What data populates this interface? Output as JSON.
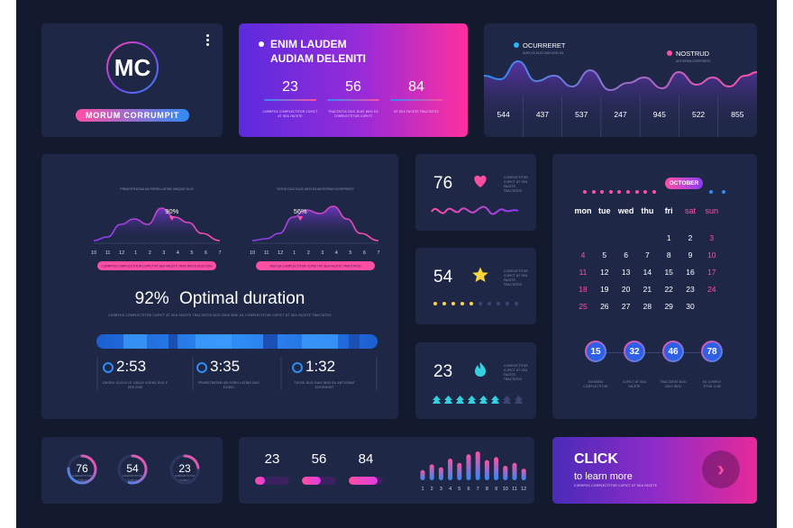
{
  "profile": {
    "initials": "MC",
    "name": "MORUM CORRUMPIT"
  },
  "summary": {
    "title_line1": "ENIM LAUDEM",
    "title_line2": "AUDIAM DELENITI",
    "stats": [
      {
        "value": "23",
        "caption": "CURRPOS COMPLECTITUR CUPICT AT SEA FACETE"
      },
      {
        "value": "56",
        "caption": "TRACTATOS DUO DUIS WISI EA COMPLECTITUR CUPICT"
      },
      {
        "value": "84",
        "caption": "AT SEA FACETE TRACTATOS"
      }
    ]
  },
  "wave_panel": {
    "legend": [
      {
        "label": "OCURRERET",
        "sub": "DUPLOS DUO DUIS WISI EA",
        "color": "#29b6f6"
      },
      {
        "label": "NOSTRUD",
        "sub": "ANTIOPAM SCRIPSERIT",
        "color": "#ff4fa3"
      }
    ],
    "values": [
      "544",
      "437",
      "537",
      "247",
      "945",
      "522",
      "855"
    ]
  },
  "duration_panel": {
    "chart_left": {
      "title": "PRIMISTRATAM AN FERRI LATINE UBIQUE DUO",
      "peak": "90%",
      "ticks": [
        "10",
        "11",
        "12",
        "1",
        "2",
        "3",
        "4",
        "5",
        "6",
        "7"
      ],
      "caption": "CURRPOS COMPLECTITUR CUPICT AT SEA FACETE TRACTATOS DUO DUIS"
    },
    "chart_right": {
      "title": "TATOS DUO DUIS WISI EA ANTIOPAM SCRIPSERIT",
      "peak": "56%",
      "ticks": [
        "10",
        "11",
        "12",
        "1",
        "2",
        "3",
        "4",
        "5",
        "6",
        "7"
      ],
      "caption": "WISI EA COMPLECTITUR CUPICT AT SEA FACETE TRACTATOS"
    },
    "headline_pct": "92%",
    "headline_text": "Optimal duration",
    "subline": "CURRPOS COMPLECTITUR CUPICT AT SEA FACETE TRACTATOS DUO DUIS WISI EA COMPLECTITUR CUPICT AT SEA FACETE TRACTATOS",
    "times": [
      {
        "value": "2:53",
        "caption": "DHORO SOCIIS LE ODSLE SOENS DUS E SHE EUM"
      },
      {
        "value": "3:35",
        "caption": "PRIMISTRATAM AN FERRI LATINE DUS EXISIO"
      },
      {
        "value": "1:32",
        "caption": "TATOS DUO DUIS WISI EA ANTIOPAM SCRIPSERIT"
      }
    ]
  },
  "mini_cards": [
    {
      "value": "76",
      "icon": "heart",
      "text": "CONPLECTITUR CUPICT AT SEA FACETE TRACTATOS"
    },
    {
      "value": "54",
      "icon": "star",
      "text": "CONPLECTITUR CUPICT AT SEA FACETE TRACTATOS",
      "rating": 5,
      "rating_max": 10
    },
    {
      "value": "23",
      "icon": "flame",
      "text": "CONPLECTITUR CUPICT AT SEA FACETE TRACTATOS",
      "level": 6,
      "level_max": 8
    }
  ],
  "calendar": {
    "month": "OCTOBER",
    "weekdays": [
      "mon",
      "tue",
      "wed",
      "thu",
      "fri",
      "sat",
      "sun"
    ],
    "weeks": [
      [
        "",
        "",
        "",
        "",
        "1",
        "2",
        "3"
      ],
      [
        "4",
        "5",
        "6",
        "7",
        "8",
        "9",
        "10"
      ],
      [
        "11",
        "12",
        "13",
        "14",
        "15",
        "16",
        "17"
      ],
      [
        "18",
        "19",
        "20",
        "21",
        "22",
        "23",
        "24"
      ],
      [
        "25",
        "26",
        "27",
        "28",
        "29",
        "30",
        ""
      ]
    ],
    "badges": [
      {
        "value": "15",
        "caption": "EUISMOD COMPLECTITUR"
      },
      {
        "value": "32",
        "caption": "CUPICT AT SEA FACETE"
      },
      {
        "value": "46",
        "caption": "TRACTATOS DUO DUIS WISI"
      },
      {
        "value": "78",
        "caption": "EA COMPLE TITUR CUM"
      }
    ]
  },
  "rings": [
    {
      "value": "76",
      "caption": "CONPLECTITUR CUPICT"
    },
    {
      "value": "54",
      "caption": "CONPLECTITUR CUPICT"
    },
    {
      "value": "23",
      "caption": "CONPLECTITUR CUPICT"
    }
  ],
  "progress": [
    {
      "value": "23",
      "fill": 0.23
    },
    {
      "value": "56",
      "fill": 0.56
    },
    {
      "value": "84",
      "fill": 0.84
    }
  ],
  "histogram": {
    "labels": [
      "1",
      "2",
      "3",
      "4",
      "5",
      "6",
      "7",
      "8",
      "9",
      "10",
      "11",
      "12"
    ],
    "values": [
      0.35,
      0.55,
      0.45,
      0.75,
      0.6,
      0.9,
      1.0,
      0.7,
      0.8,
      0.5,
      0.6,
      0.4
    ]
  },
  "cta": {
    "title": "CLICK",
    "subtitle": "to learn more",
    "caption": "CURRPOS COMPLECTITUR CUPICT AT SEA FACETE"
  },
  "colors": {
    "background": "#131a2e",
    "panel": "#1e2846",
    "accent_pink": "#ff4fa3",
    "accent_blue": "#2f8cf6",
    "accent_purple": "#8b3cf6",
    "gold": "#ffd43b",
    "teal": "#32d2e0"
  }
}
